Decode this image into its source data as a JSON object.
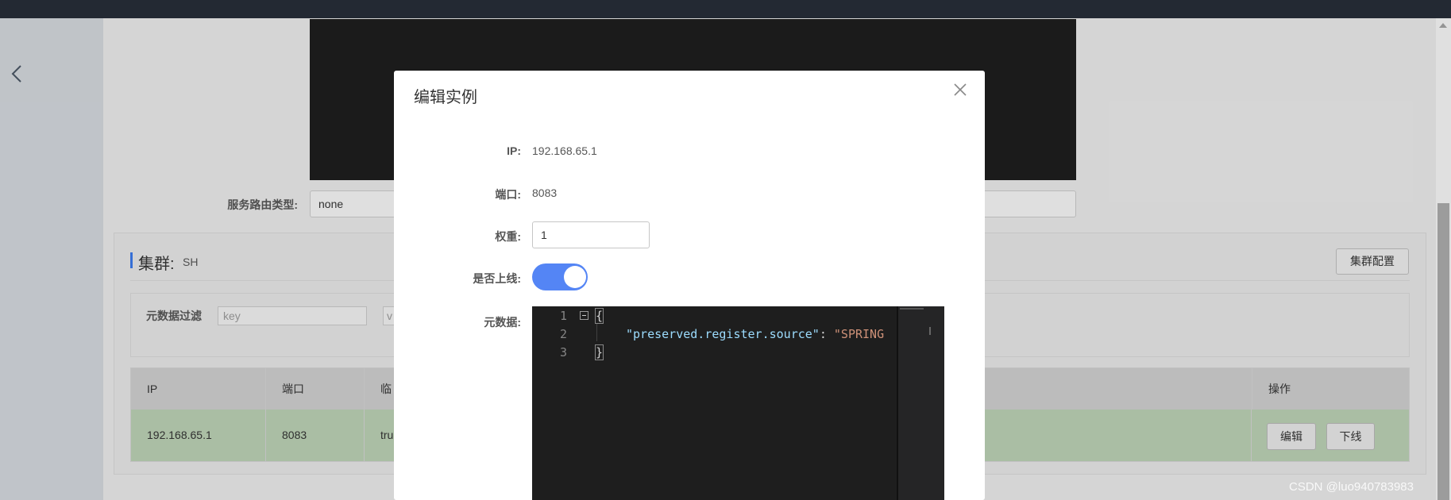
{
  "page": {
    "route_type_label": "服务路由类型:",
    "route_type_value": "none"
  },
  "cluster": {
    "title": "集群:",
    "name": "SH",
    "config_button": "集群配置",
    "filter_label": "元数据过滤",
    "filter_key_placeholder": "key",
    "filter_value_placeholder": "v"
  },
  "table": {
    "headers": [
      "IP",
      "端口",
      "临",
      "操作"
    ],
    "rows": [
      {
        "ip": "192.168.65.1",
        "port": "8083",
        "ephemeral": "tru"
      }
    ],
    "edit_button": "编辑",
    "offline_button": "下线"
  },
  "modal": {
    "title": "编辑实例",
    "ip_label": "IP:",
    "ip_value": "192.168.65.1",
    "port_label": "端口:",
    "port_value": "8083",
    "weight_label": "权重:",
    "weight_value": "1",
    "online_label": "是否上线:",
    "online_enabled": true,
    "metadata_label": "元数据:",
    "editor": {
      "line_numbers": [
        "1",
        "2",
        "3"
      ],
      "line1": "{",
      "line2_key": "\"preserved.register.source\"",
      "line2_colon": ": ",
      "line2_value": "\"SPRING",
      "line3": "}"
    }
  },
  "watermark": "CSDN @luo940783983",
  "colors": {
    "accent_blue": "#5485f5",
    "row_green": "#b7cdb1",
    "topbar": "#262d37",
    "editor_bg": "#1e1e1e"
  }
}
